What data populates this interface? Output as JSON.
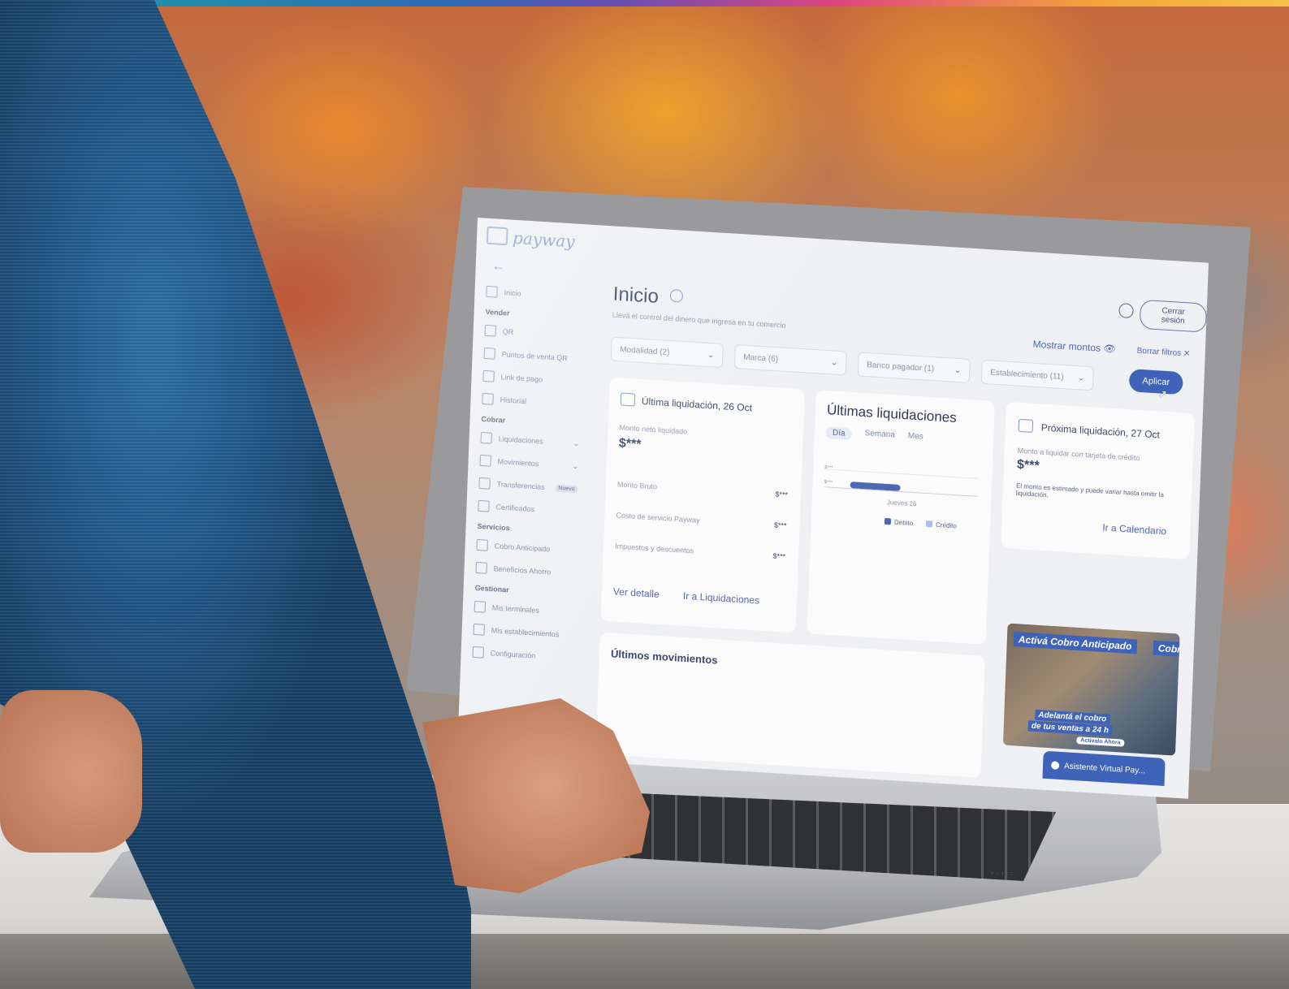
{
  "app": {
    "brand": "payway"
  },
  "header": {
    "logout_label": "Cerrar sesión",
    "show_amounts_label": "Mostrar montos 👁",
    "clear_filters_label": "Borrar filtros ✕"
  },
  "page": {
    "title": "Inicio",
    "subtitle": "Llevá el control del dinero que ingresa en tu comercio"
  },
  "sidebar": {
    "items": [
      {
        "label": "Inicio"
      },
      {
        "section": "Vender"
      },
      {
        "label": "QR"
      },
      {
        "label": "Puntos de venta QR"
      },
      {
        "label": "Link de pago"
      },
      {
        "label": "Historial"
      },
      {
        "section": "Cobrar"
      },
      {
        "label": "Liquidaciones"
      },
      {
        "label": "Movimientos"
      },
      {
        "label": "Transferencias",
        "badge": "Nuevo"
      },
      {
        "label": "Certificados"
      },
      {
        "section": "Servicios"
      },
      {
        "label": "Cobro Anticipado"
      },
      {
        "label": "Beneficios Ahorro"
      },
      {
        "section": "Gestionar"
      },
      {
        "label": "Mis terminales"
      },
      {
        "label": "Mis establecimientos"
      },
      {
        "label": "Configuración"
      }
    ]
  },
  "filters": {
    "items": [
      "Modalidad (2)",
      "Marca (6)",
      "Banco pagador (1)",
      "Establecimiento (11)"
    ],
    "apply_label": "Aplicar"
  },
  "last_settlement": {
    "title": "Última liquidación, 26 Oct",
    "net_label": "Monto neto liquidado",
    "net_value": "$***",
    "rows": [
      {
        "label": "Monto Bruto",
        "value": "$***"
      },
      {
        "label": "Costo de servicio Payway",
        "value": "$***"
      },
      {
        "label": "Impuestos y descuentos",
        "value": "$***"
      }
    ],
    "detail_link": "Ver detalle",
    "go_link": "Ir a Liquidaciones"
  },
  "recent_settlements": {
    "title": "Últimas liquidaciones",
    "tabs": [
      "Día",
      "Semana",
      "Mes"
    ],
    "active_tab": "Día",
    "y_ticks": [
      "$***",
      "$***"
    ],
    "x_label": "Jueves 26",
    "legend": [
      {
        "label": "Débito",
        "color": "#4f68b4"
      },
      {
        "label": "Crédito",
        "color": "#a9c0ea"
      }
    ]
  },
  "next_settlement": {
    "title": "Próxima liquidación, 27 Oct",
    "label": "Monto a liquidar con tarjeta de crédito",
    "value": "$***",
    "note": "El monto es estimado y puede variar hasta emitir la liquidación.",
    "link": "Ir a Calendario"
  },
  "movements": {
    "title": "Últimos movimientos"
  },
  "promo": {
    "title": "Activá Cobro Anticipado",
    "title_cut": "Cobr",
    "line1": "Adelantá el cobro",
    "line2": "de tus ventas a 24 h",
    "cta": "Activalo Ahora"
  },
  "assistant": {
    "label": "Asistente Virtual Pay..."
  },
  "colors": {
    "accent": "#3f63b8",
    "link": "#4f68b4",
    "sweater": "#1f5686"
  },
  "icons": [
    "arrow-left-icon",
    "grid-icon",
    "qr-icon",
    "link-icon",
    "history-icon",
    "wallet-icon",
    "shuffle-icon",
    "folder-icon",
    "database-icon",
    "people-icon",
    "phone-icon",
    "building-icon",
    "sliders-icon",
    "user-icon",
    "eye-icon",
    "info-icon",
    "chat-icon"
  ]
}
